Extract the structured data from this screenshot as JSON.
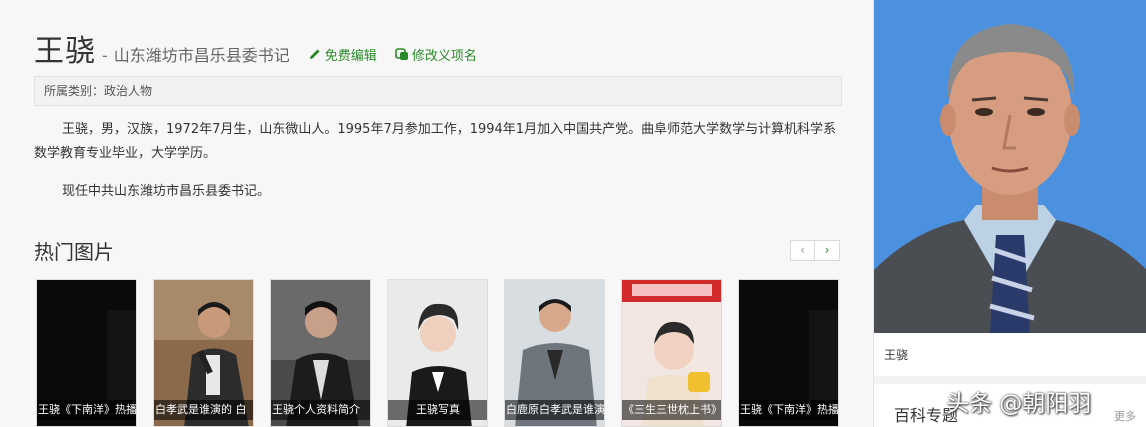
{
  "header": {
    "name": "王骁",
    "dash": "-",
    "subtitle": "山东潍坊市昌乐县委书记",
    "edit_label": "免费编辑",
    "rename_label": "修改义项名"
  },
  "category": "所属类别：政治人物",
  "paragraphs": [
    "王骁，男，汉族，1972年7月生，山东微山人。1995年7月参加工作，1994年1月加入中国共产党。曲阜师范大学数学与计算机科学系数学教育专业毕业，大学学历。",
    "现任中共山东潍坊市昌乐县委书记。"
  ],
  "hot_images": {
    "title": "热门图片",
    "prev": "‹",
    "next": "›",
    "items": [
      {
        "caption": "王骁《下南洋》热播"
      },
      {
        "caption": "白孝武是谁演的 白"
      },
      {
        "caption": "王骁个人资料简介"
      },
      {
        "caption": "王骁写真"
      },
      {
        "caption": "白鹿原白孝武是谁演"
      },
      {
        "caption": "《三生三世枕上书》"
      },
      {
        "caption": "王骁《下南洋》热播"
      }
    ]
  },
  "sidebar": {
    "portrait_caption": "王骁",
    "section_title": "百科专题",
    "more": "更多"
  },
  "watermark": "头条 @朝阳羽",
  "colors": {
    "accent_green": "#2a8a2a",
    "background": "#f7f7f7"
  }
}
